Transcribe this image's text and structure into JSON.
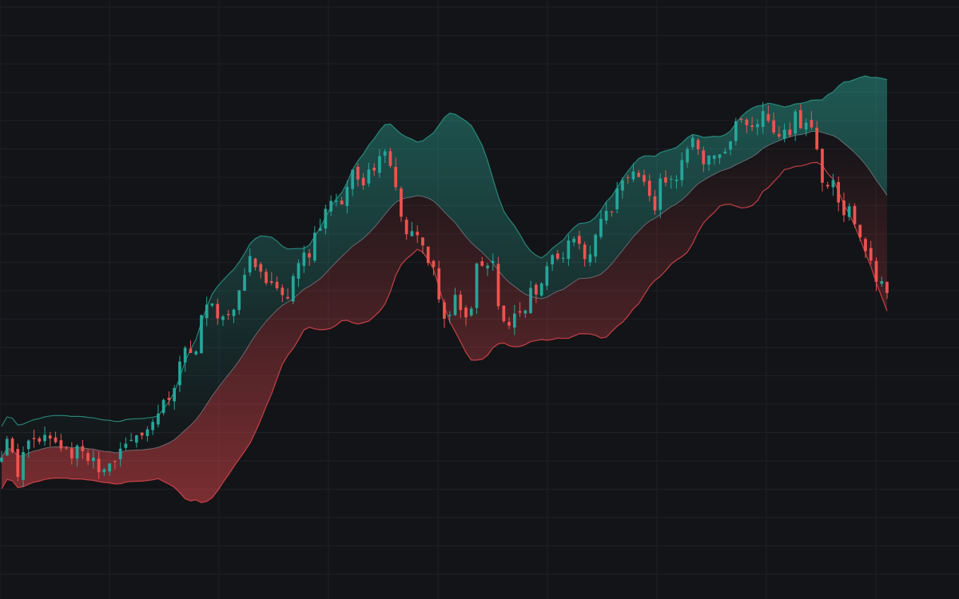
{
  "chart_data": {
    "type": "candlestick",
    "indicator": "bollinger-bands",
    "title": "",
    "xlabel": "",
    "ylabel": "",
    "grid": true,
    "legend": "none",
    "ylim": [
      0,
      100
    ],
    "bars": 165,
    "colors": {
      "background": "#131417",
      "grid": "#1f2026",
      "up": "#26a69a",
      "down": "#ef5350",
      "upper_band": "#2a9d8f",
      "lower_band": "#e0474c",
      "middle_band": "#8a8f98"
    },
    "close_anchors": [
      [
        0,
        18
      ],
      [
        12,
        23
      ],
      [
        22,
        14
      ],
      [
        32,
        22
      ],
      [
        40,
        25
      ],
      [
        52,
        23
      ],
      [
        62,
        25
      ],
      [
        72,
        24
      ],
      [
        80,
        19
      ],
      [
        88,
        20
      ],
      [
        96,
        22
      ],
      [
        110,
        18
      ],
      [
        118,
        17
      ],
      [
        128,
        16
      ],
      [
        144,
        20
      ],
      [
        154,
        21
      ],
      [
        172,
        24
      ],
      [
        186,
        24
      ],
      [
        200,
        32
      ],
      [
        216,
        34
      ],
      [
        228,
        47
      ],
      [
        236,
        47
      ],
      [
        244,
        43
      ],
      [
        252,
        51
      ],
      [
        266,
        56
      ],
      [
        284,
        51
      ],
      [
        300,
        58
      ],
      [
        312,
        67
      ],
      [
        322,
        63
      ],
      [
        338,
        62
      ],
      [
        350,
        56
      ],
      [
        362,
        57
      ],
      [
        372,
        64
      ],
      [
        386,
        68
      ],
      [
        400,
        76
      ],
      [
        414,
        82
      ],
      [
        428,
        80
      ],
      [
        440,
        87
      ],
      [
        456,
        85
      ],
      [
        468,
        90
      ],
      [
        484,
        92
      ],
      [
        500,
        80
      ],
      [
        512,
        71
      ],
      [
        526,
        73
      ],
      [
        540,
        65
      ],
      [
        556,
        53
      ],
      [
        570,
        56
      ],
      [
        584,
        51
      ],
      [
        600,
        67
      ],
      [
        616,
        65
      ],
      [
        628,
        50
      ],
      [
        640,
        52
      ],
      [
        660,
        56
      ],
      [
        676,
        62
      ],
      [
        690,
        67
      ],
      [
        704,
        68
      ],
      [
        718,
        72
      ],
      [
        732,
        67
      ],
      [
        748,
        74
      ],
      [
        764,
        79
      ],
      [
        780,
        85
      ],
      [
        796,
        86
      ],
      [
        806,
        85
      ],
      [
        818,
        79
      ],
      [
        830,
        87
      ],
      [
        850,
        87
      ],
      [
        866,
        96
      ],
      [
        880,
        89
      ],
      [
        896,
        93
      ],
      [
        912,
        94
      ],
      [
        924,
        99
      ],
      [
        940,
        96
      ],
      [
        952,
        101
      ],
      [
        964,
        98
      ],
      [
        980,
        98
      ],
      [
        986,
        97
      ],
      [
        994,
        100
      ],
      [
        1004,
        98
      ],
      [
        1016,
        97
      ],
      [
        1024,
        90
      ],
      [
        1034,
        83
      ],
      [
        1044,
        84
      ],
      [
        1054,
        79
      ],
      [
        1064,
        77
      ],
      [
        1074,
        72
      ],
      [
        1084,
        68
      ],
      [
        1096,
        62
      ],
      [
        1110,
        60
      ]
    ]
  }
}
